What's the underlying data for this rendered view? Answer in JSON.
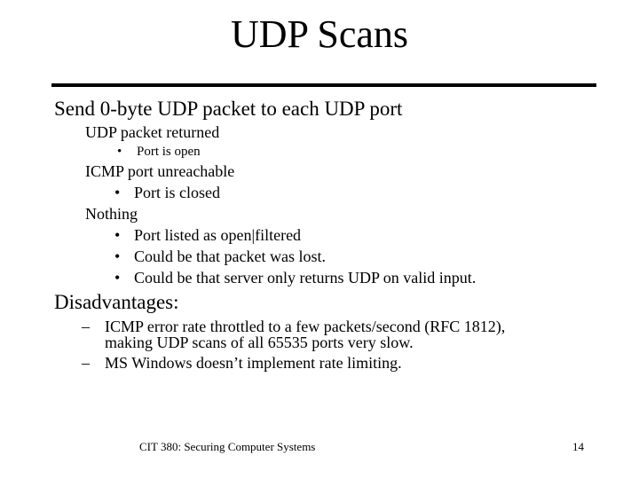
{
  "slide": {
    "title": "UDP Scans",
    "items": [
      {
        "text": "Send 0-byte UDP packet to each UDP port"
      },
      {
        "text": "UDP packet returned"
      },
      {
        "bullet": "•",
        "text": "Port is open"
      },
      {
        "text": "ICMP port unreachable"
      },
      {
        "bullet": "•",
        "text": "Port is closed"
      },
      {
        "text": "Nothing"
      },
      {
        "bullet": "•",
        "text": "Port listed as open|filtered"
      },
      {
        "bullet": "•",
        "text": "Could be that packet was lost."
      },
      {
        "bullet": "•",
        "text": "Could be that server only returns UDP on valid input."
      },
      {
        "text": "Disadvantages:"
      },
      {
        "bullet": "–",
        "text": "ICMP error rate throttled to a few packets/second (RFC 1812),"
      },
      {
        "text": "making UDP scans of all 65535 ports very slow."
      },
      {
        "bullet": "–",
        "text": "MS Windows doesn’t implement rate limiting."
      }
    ],
    "footer": {
      "course": "CIT 380: Securing Computer Systems",
      "page_number": "14"
    }
  }
}
